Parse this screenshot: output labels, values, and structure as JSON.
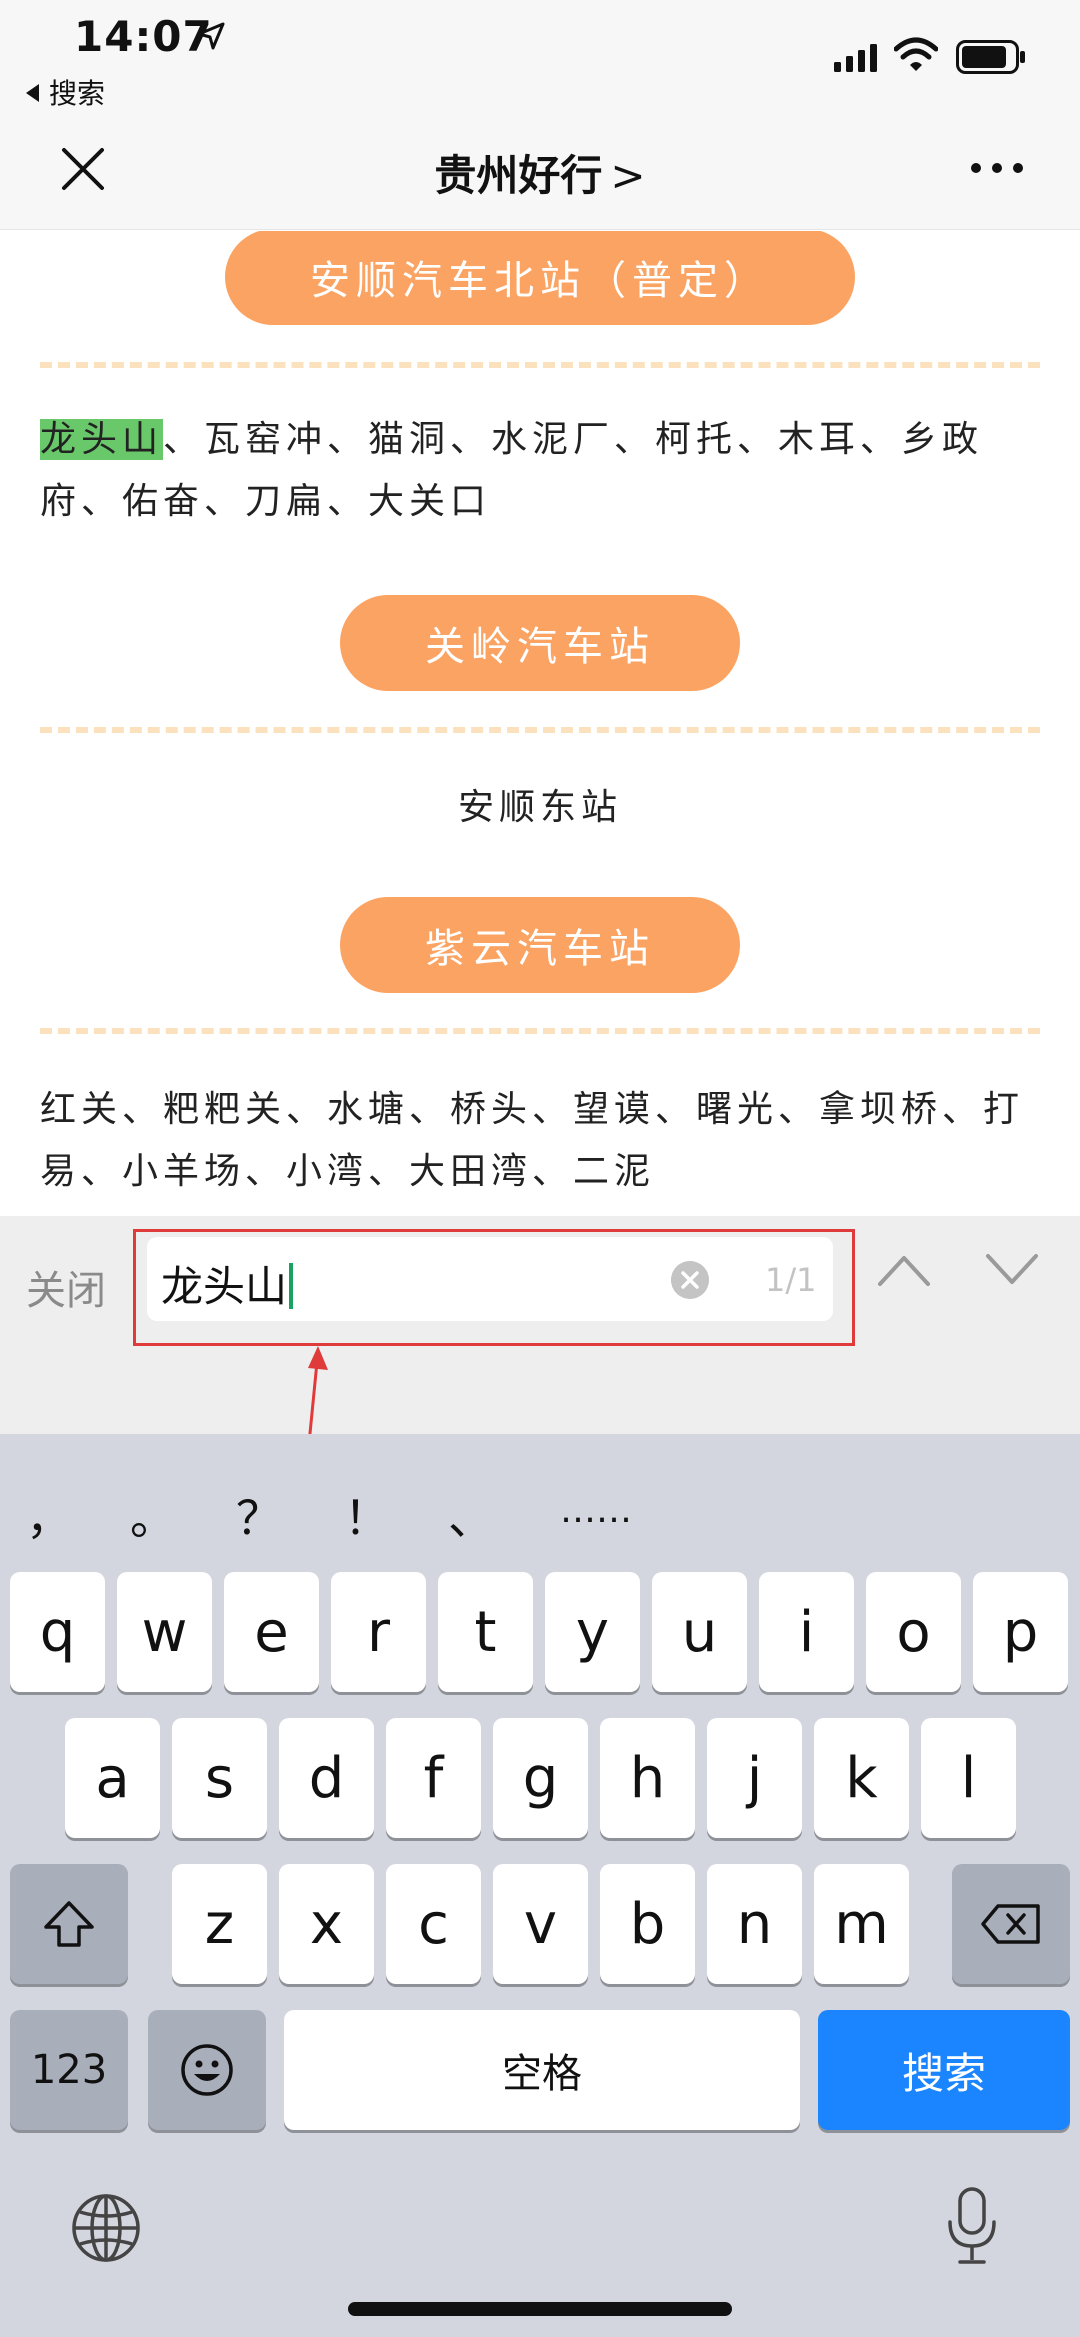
{
  "status": {
    "time": "14:07",
    "back_app": "搜索"
  },
  "nav": {
    "title": "贵州好行",
    "title_chevron": ">"
  },
  "stations": [
    {
      "name": "安顺汽车北站（普定）",
      "stops": "龙头山、瓦窑冲、猫洞、水泥厂、柯托、木耳、乡政府、佑奋、刀扁、大关口",
      "highlight": "龙头山",
      "stops_rest": "、瓦窑冲、猫洞、水泥厂、柯托、木耳、乡政府、佑奋、刀扁、大关口"
    },
    {
      "name": "关岭汽车站",
      "stops": "安顺东站"
    },
    {
      "name": "紫云汽车站",
      "stops": "红关、粑粑关、水塘、桥头、望谟、曙光、拿坝桥、打易、小羊场、小湾、大田湾、二泥"
    }
  ],
  "find_bar": {
    "close_label": "关闭",
    "query": "龙头山",
    "count": "1/1"
  },
  "keyboard": {
    "symbols": [
      "，",
      "。",
      "？",
      "！",
      "、",
      "……"
    ],
    "row1": [
      "q",
      "w",
      "e",
      "r",
      "t",
      "y",
      "u",
      "i",
      "o",
      "p"
    ],
    "row2": [
      "a",
      "s",
      "d",
      "f",
      "g",
      "h",
      "j",
      "k",
      "l"
    ],
    "row3": [
      "z",
      "x",
      "c",
      "v",
      "b",
      "n",
      "m"
    ],
    "numbers_label": "123",
    "space_label": "空格",
    "search_label": "搜索"
  },
  "colors": {
    "pill": "#fba362",
    "highlight": "#69c96a",
    "annotation_red": "#e03b3b",
    "search_key": "#1a85ff"
  }
}
